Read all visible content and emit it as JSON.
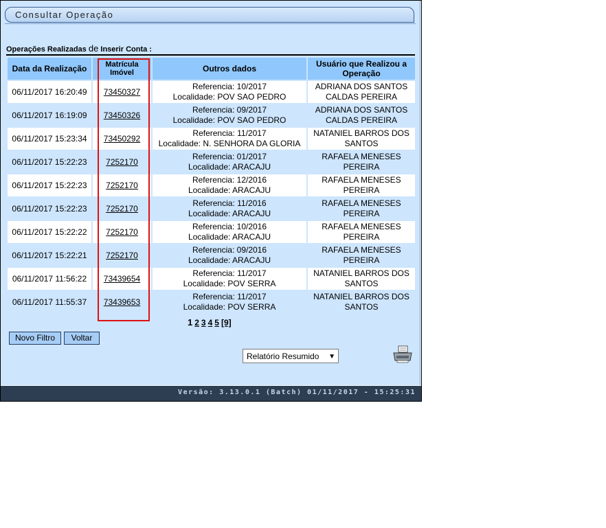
{
  "title": "Consultar Operação",
  "ops_label": {
    "prefix": "Operações Realizadas",
    "de": "de",
    "op": "Inserir Conta :"
  },
  "table": {
    "headers": [
      "Data da Realização",
      "Matrícula Imóvel",
      "Outros dados",
      "Usuário que Realizou a Operação"
    ],
    "rows": [
      {
        "data": "06/11/2017 16:20:49",
        "matricula": "73450327",
        "ref": "Referencia: 10/2017",
        "loc": "Localidade: POV SAO PEDRO",
        "usuario": "ADRIANA DOS SANTOS CALDAS PEREIRA"
      },
      {
        "data": "06/11/2017 16:19:09",
        "matricula": "73450326",
        "ref": "Referencia: 09/2017",
        "loc": "Localidade: POV SAO PEDRO",
        "usuario": "ADRIANA DOS SANTOS CALDAS PEREIRA"
      },
      {
        "data": "06/11/2017 15:23:34",
        "matricula": "73450292",
        "ref": "Referencia: 11/2017",
        "loc": "Localidade: N. SENHORA DA GLORIA",
        "usuario": "NATANIEL BARROS DOS SANTOS"
      },
      {
        "data": "06/11/2017 15:22:23",
        "matricula": "7252170",
        "ref": "Referencia: 01/2017",
        "loc": "Localidade: ARACAJU",
        "usuario": "RAFAELA MENESES PEREIRA"
      },
      {
        "data": "06/11/2017 15:22:23",
        "matricula": "7252170",
        "ref": "Referencia: 12/2016",
        "loc": "Localidade: ARACAJU",
        "usuario": "RAFAELA MENESES PEREIRA"
      },
      {
        "data": "06/11/2017 15:22:23",
        "matricula": "7252170",
        "ref": "Referencia: 11/2016",
        "loc": "Localidade: ARACAJU",
        "usuario": "RAFAELA MENESES PEREIRA"
      },
      {
        "data": "06/11/2017 15:22:22",
        "matricula": "7252170",
        "ref": "Referencia: 10/2016",
        "loc": "Localidade: ARACAJU",
        "usuario": "RAFAELA MENESES PEREIRA"
      },
      {
        "data": "06/11/2017 15:22:21",
        "matricula": "7252170",
        "ref": "Referencia: 09/2016",
        "loc": "Localidade: ARACAJU",
        "usuario": "RAFAELA MENESES PEREIRA"
      },
      {
        "data": "06/11/2017 11:56:22",
        "matricula": "73439654",
        "ref": "Referencia: 11/2017",
        "loc": "Localidade: POV SERRA",
        "usuario": "NATANIEL BARROS DOS SANTOS"
      },
      {
        "data": "06/11/2017 11:55:37",
        "matricula": "73439653",
        "ref": "Referencia: 11/2017",
        "loc": "Localidade: POV SERRA",
        "usuario": "NATANIEL BARROS DOS SANTOS"
      }
    ]
  },
  "pagination": {
    "current": "1",
    "pages": [
      "2",
      "3",
      "4",
      "5"
    ],
    "total": "[9]"
  },
  "buttons": {
    "novo_filtro": "Novo Filtro",
    "voltar": "Voltar"
  },
  "report_select": {
    "selected": "Relatório Resumido"
  },
  "footer": {
    "version": "Versão: 3.13.0.1 (Batch) 01/11/2017 - 15:25:31"
  },
  "colors": {
    "panel_bg": "#cde5fd",
    "header_bg": "#90c7fc",
    "footer_bg": "#2e3e52",
    "highlight_border": "#e01010"
  },
  "icons": {
    "print": "printer-icon"
  }
}
